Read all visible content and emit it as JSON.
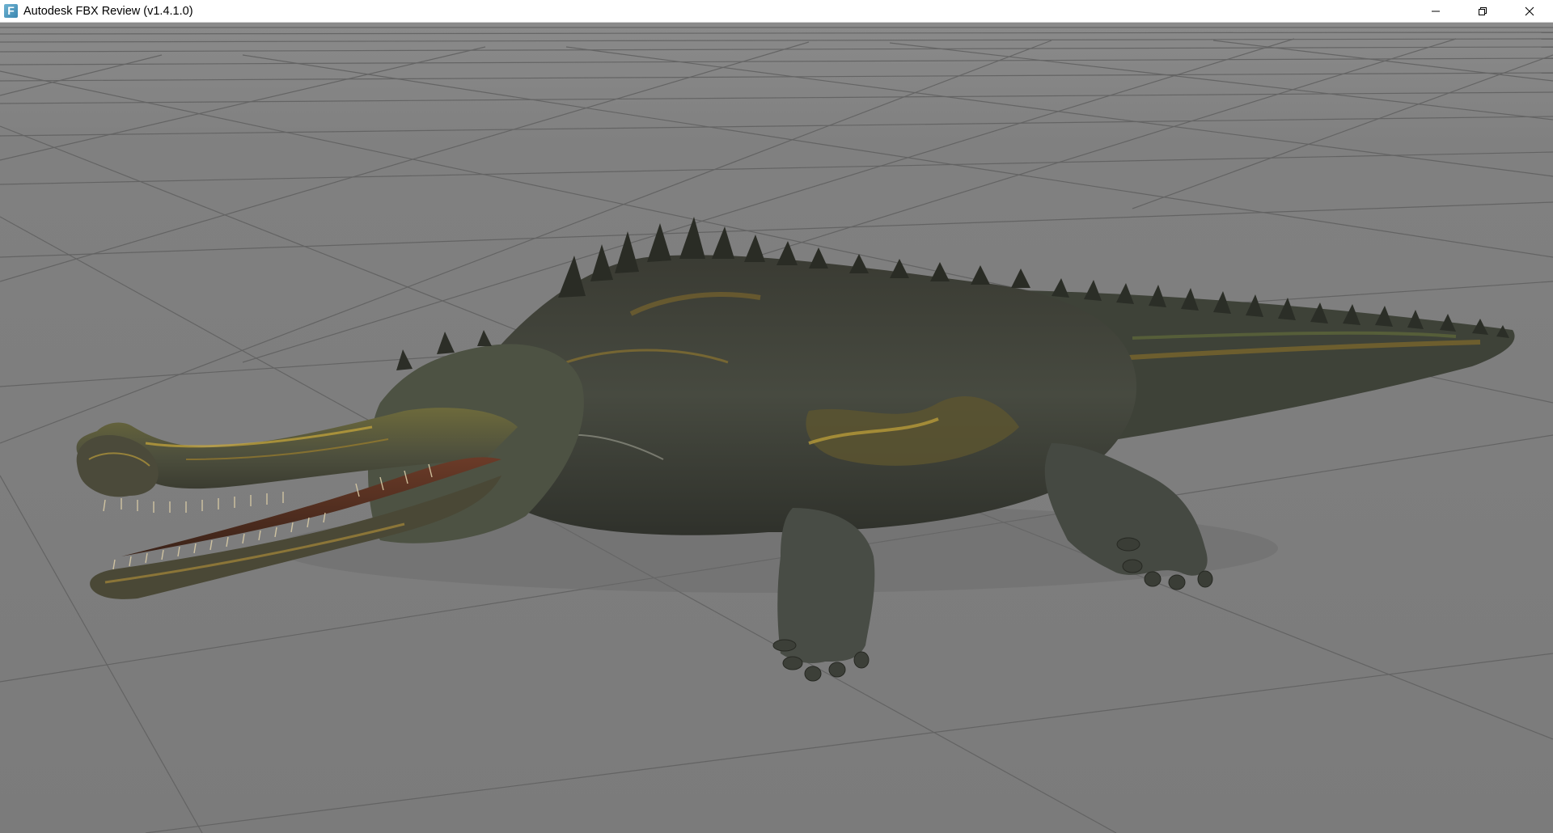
{
  "window": {
    "title": "Autodesk FBX Review (v1.4.1.0)",
    "icon_letter": "F",
    "controls": [
      "minimize-icon",
      "restore-icon",
      "close-icon"
    ]
  },
  "viewport": {
    "background_color": "#7d7d7d",
    "grid_color": "#5e5e5e",
    "model": "gharial-crocodile"
  },
  "colors": {
    "icon_accent": "#3a86b0",
    "skin_dark": "#3b3f36",
    "skin_gold": "#a8862a"
  }
}
